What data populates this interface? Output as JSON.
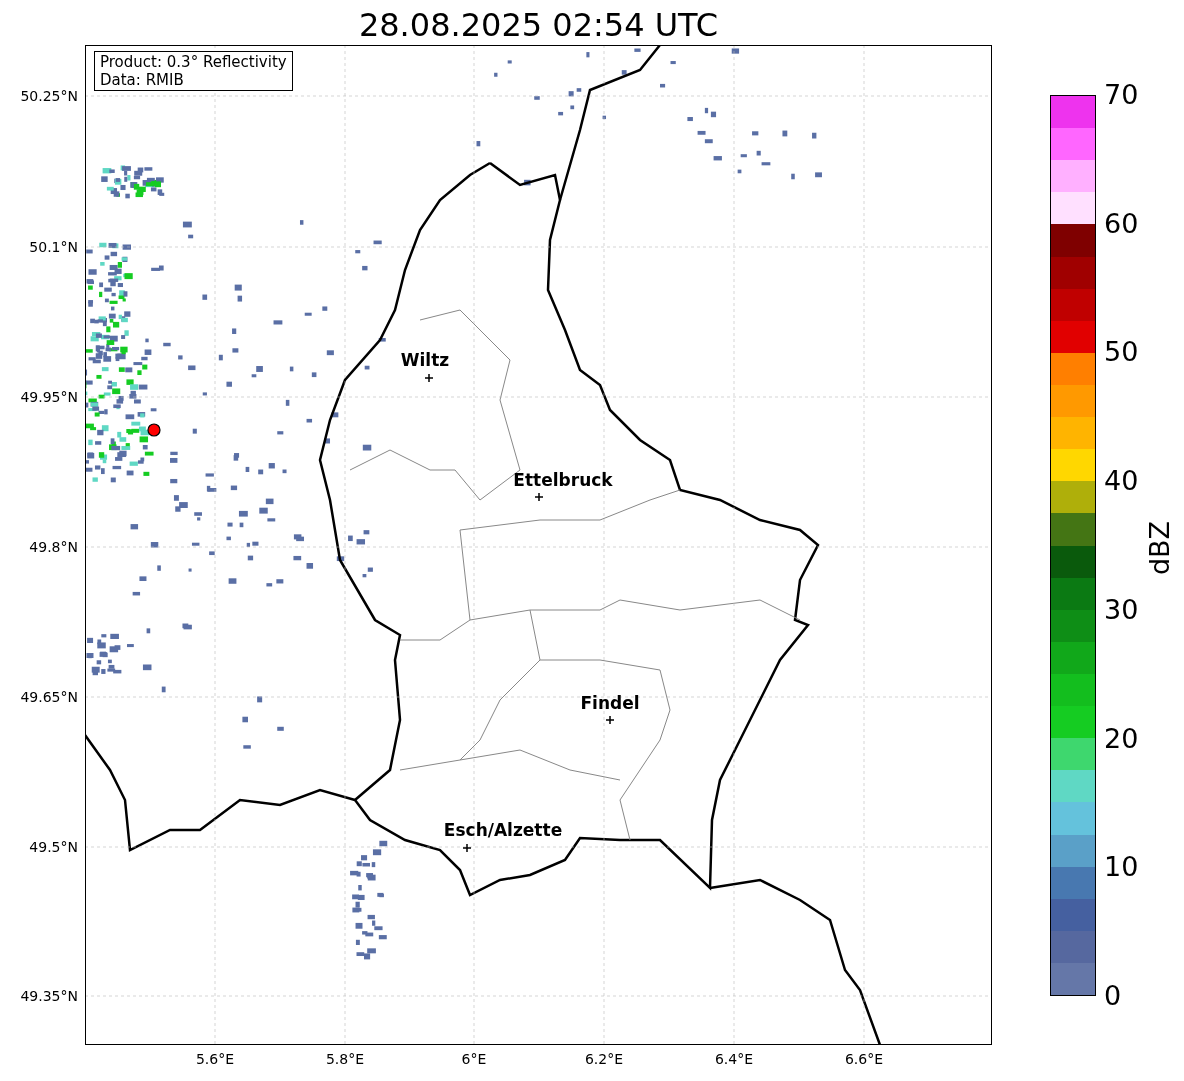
{
  "title": "28.08.2025 02:54 UTC",
  "info_box": [
    "Product: 0.3° Reflectivity",
    "Data: RMIB"
  ],
  "cities": [
    {
      "name": "Wiltz",
      "kind": "city"
    },
    {
      "name": "Ettelbruck",
      "kind": "city"
    },
    {
      "name": "Findel",
      "kind": "city"
    },
    {
      "name": "Esch/Alzette",
      "kind": "city"
    }
  ],
  "x_ticks": [
    "5.6°E",
    "5.8°E",
    "6°E",
    "6.2°E",
    "6.4°E",
    "6.6°E"
  ],
  "y_ticks": [
    "50.25°N",
    "50.1°N",
    "49.95°N",
    "49.8°N",
    "49.65°N",
    "49.5°N",
    "49.35°N"
  ],
  "colorbar": {
    "label": "dBZ",
    "ticks": [
      "70",
      "60",
      "50",
      "40",
      "30",
      "20",
      "10",
      "0"
    ],
    "segments": [
      {
        "color": "#ee33ee"
      },
      {
        "color": "#ff66ff"
      },
      {
        "color": "#ffb0ff"
      },
      {
        "color": "#ffe0ff"
      },
      {
        "color": "#7f0000"
      },
      {
        "color": "#a00000"
      },
      {
        "color": "#c00000"
      },
      {
        "color": "#e10000"
      },
      {
        "color": "#ff7f00"
      },
      {
        "color": "#ff9900"
      },
      {
        "color": "#ffb400"
      },
      {
        "color": "#ffd700"
      },
      {
        "color": "#afaf0a"
      },
      {
        "color": "#447514"
      },
      {
        "color": "#0a5a0c"
      },
      {
        "color": "#0b7a13"
      },
      {
        "color": "#0e8e16"
      },
      {
        "color": "#11a81a"
      },
      {
        "color": "#13be1e"
      },
      {
        "color": "#15cc22"
      },
      {
        "color": "#3ed76e"
      },
      {
        "color": "#5fd8c4"
      },
      {
        "color": "#64c2dc"
      },
      {
        "color": "#5aa0c8"
      },
      {
        "color": "#4878b0"
      },
      {
        "color": "#4560a0"
      },
      {
        "color": "#56689f"
      },
      {
        "color": "#6577a8"
      }
    ]
  }
}
